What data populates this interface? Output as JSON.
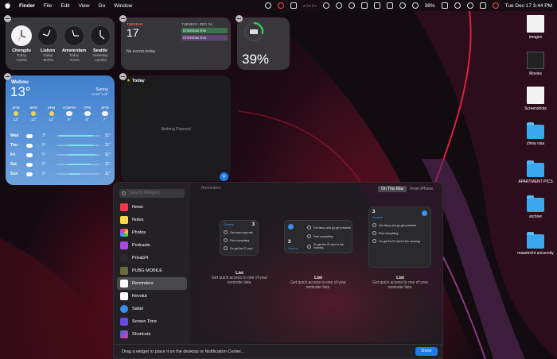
{
  "menubar": {
    "app": "Finder",
    "items": [
      "File",
      "Edit",
      "View",
      "Go",
      "Window"
    ],
    "status": "--:--:--",
    "battery": "38%",
    "datetime": "Tue Dec 17  3:44 PM"
  },
  "clocks": [
    {
      "city": "Chengdu",
      "day": "Today",
      "offset": "+0HRS"
    },
    {
      "city": "Lisbon",
      "day": "Today",
      "offset": "-8HRS"
    },
    {
      "city": "Amsterdam",
      "day": "Today",
      "offset": "-7HRS"
    },
    {
      "city": "Seattle",
      "day": "Yesterday",
      "offset": "-16HRS"
    }
  ],
  "calendar": {
    "day_name": "TUESDAY",
    "day_number": "17",
    "upcoming_head": "TUESDAY, DEC 24",
    "events": [
      "Christmas Eve",
      "Christmas Eve"
    ],
    "no_events": "No events today"
  },
  "battery_widget": {
    "percent": "39%"
  },
  "weather": {
    "city": "Wuhou",
    "temp": "13°",
    "condition": "Sunny",
    "high_low": "H:13° L:4°",
    "hours": [
      {
        "time": "4PM",
        "temp": "13°"
      },
      {
        "time": "5PM",
        "temp": "13°"
      },
      {
        "time": "6PM",
        "temp": "11°"
      },
      {
        "time": "6:05PM",
        "temp": "9°"
      },
      {
        "time": "7PM",
        "temp": "8°"
      },
      {
        "time": "8PM",
        "temp": "7°"
      }
    ],
    "days": [
      {
        "name": "Wed",
        "low": "3°",
        "high": "11°"
      },
      {
        "name": "Thu",
        "low": "5°",
        "high": "11°"
      },
      {
        "name": "Fri",
        "low": "5°",
        "high": "11°"
      },
      {
        "name": "Sat",
        "low": "5°",
        "high": "11°"
      },
      {
        "name": "Sun",
        "low": "5°",
        "high": "11°"
      }
    ]
  },
  "today": {
    "title": "Today",
    "empty": "Nothing Planned"
  },
  "desktop": [
    {
      "label": "images"
    },
    {
      "label": "Movies"
    },
    {
      "label": "Screenshots"
    },
    {
      "label": "china visa"
    },
    {
      "label": "APARTMENT PICS"
    },
    {
      "label": "archive"
    },
    {
      "label": "maastricht university"
    }
  ],
  "gallery": {
    "search_placeholder": "Search Widgets",
    "apps": [
      "News",
      "Notes",
      "Photos",
      "Podcasts",
      "Privat24",
      "PUBG MOBILE",
      "Reminders",
      "Revolut",
      "Safari",
      "Screen Time",
      "Shortcuts"
    ],
    "selected": "Reminders",
    "header": "Reminders",
    "seg_on": "On This Mac",
    "seg_off": "From iPhone",
    "widgets": [
      {
        "list": "General",
        "count": "3",
        "rows": [
          "Get mom keys ash",
          "Print everything",
          "Go get the ID card"
        ],
        "title": "List",
        "desc": "Get quick access to one of your reminder lists."
      },
      {
        "list": "General",
        "count": "3",
        "rows": [
          "Get fancy and go get presents",
          "Print everything",
          "Go get the ID card in the morning"
        ],
        "title": "List",
        "desc": "Get quick access to one of your reminder lists."
      },
      {
        "list": "General",
        "count": "3",
        "rows": [
          "Get fancy and go get presents",
          "Print everything",
          "Go get the ID card in the morning"
        ],
        "title": "List",
        "desc": "Get quick access to one of your reminder lists."
      }
    ],
    "footer": "Drag a widget to place it on the desktop or Notification Center...",
    "done": "Done"
  },
  "colors": {
    "accent": "#1f7ae8",
    "battery_ring": "#34c759",
    "weather_bar": "#7fe0e8"
  }
}
